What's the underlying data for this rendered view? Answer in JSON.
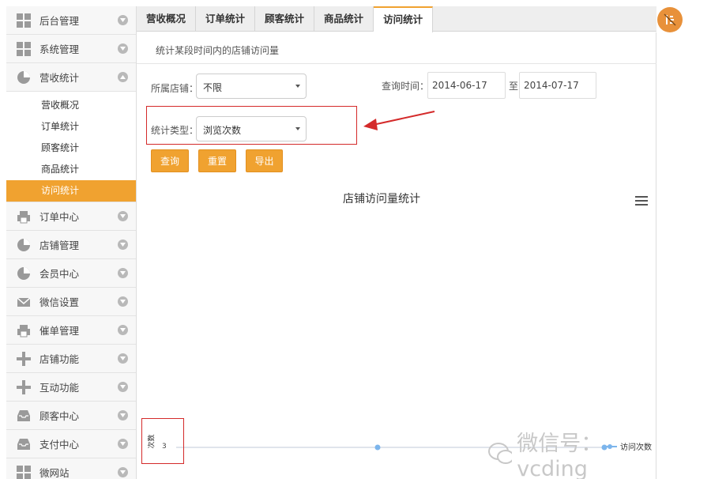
{
  "sidebar": {
    "items_top": [
      {
        "label": "后台管理",
        "icon": "grid-icon"
      },
      {
        "label": "系统管理",
        "icon": "grid-icon"
      },
      {
        "label": "营收统计",
        "icon": "pie-chart-icon",
        "expanded": true
      }
    ],
    "submenu": [
      {
        "label": "营收概况"
      },
      {
        "label": "订单统计"
      },
      {
        "label": "顾客统计"
      },
      {
        "label": "商品统计"
      },
      {
        "label": "访问统计",
        "active": true
      }
    ],
    "items_bottom": [
      {
        "label": "订单中心",
        "icon": "printer-icon"
      },
      {
        "label": "店铺管理",
        "icon": "pie-chart-icon"
      },
      {
        "label": "会员中心",
        "icon": "pie-chart-icon"
      },
      {
        "label": "微信设置",
        "icon": "mail-icon"
      },
      {
        "label": "催单管理",
        "icon": "printer-icon"
      },
      {
        "label": "店铺功能",
        "icon": "plus-icon"
      },
      {
        "label": "互动功能",
        "icon": "plus-icon"
      },
      {
        "label": "顾客中心",
        "icon": "inbox-icon"
      },
      {
        "label": "支付中心",
        "icon": "inbox-icon"
      },
      {
        "label": "微网站",
        "icon": "grid-icon"
      }
    ]
  },
  "tabs": [
    {
      "label": "营收概况"
    },
    {
      "label": "订单统计"
    },
    {
      "label": "顾客统计"
    },
    {
      "label": "商品统计"
    },
    {
      "label": "访问统计",
      "active": true
    }
  ],
  "main": {
    "description": "统计某段时间内的店铺访问量",
    "store_label": "所属店铺：",
    "store_value": "不限",
    "query_time_label": "查询时间：",
    "date_from": "2014-06-17",
    "date_sep": "至",
    "date_to": "2014-07-17",
    "stat_type_label": "统计类型：",
    "stat_type_value": "浏览次数",
    "buttons": {
      "query": "查询",
      "reset": "重置",
      "export": "导出"
    }
  },
  "chart_data": {
    "type": "line",
    "title": "店铺访问量统计",
    "ylabel": "次数",
    "yticks": [
      "3"
    ],
    "series": [
      {
        "name": "访问次数",
        "values": [
          3,
          3
        ]
      }
    ]
  },
  "watermark": "微信号：vcding",
  "colors": {
    "accent": "#f0a230",
    "highlight": "#d42a2a",
    "series": "#7cb5ec"
  }
}
